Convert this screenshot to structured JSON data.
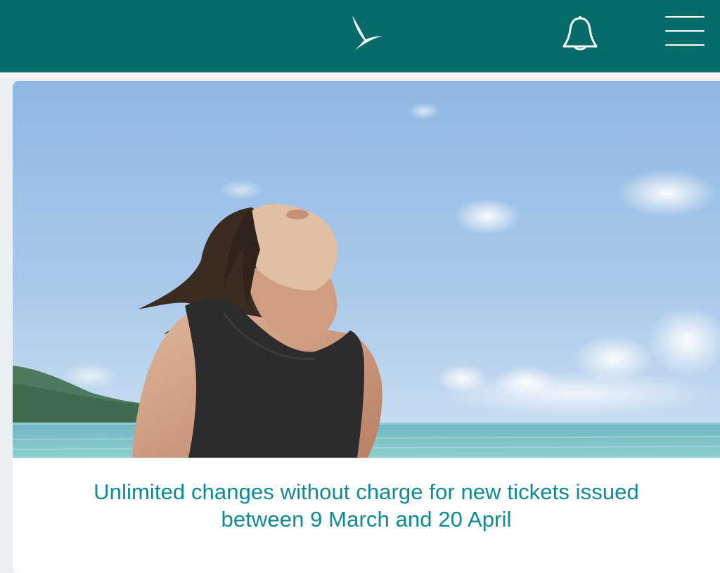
{
  "header": {
    "background_color": "#066b69",
    "logo_icon": "brushwing-logo-icon",
    "notification_icon": "bell-icon",
    "menu_icon": "hamburger-menu-icon"
  },
  "promo_card": {
    "image_alt": "Girl looking up at the sky on a beach",
    "headline_line1": "Unlimited changes without charge for new tickets issued",
    "headline_line2": "between 9 March and 20 April",
    "headline_color": "#0d8a96"
  }
}
